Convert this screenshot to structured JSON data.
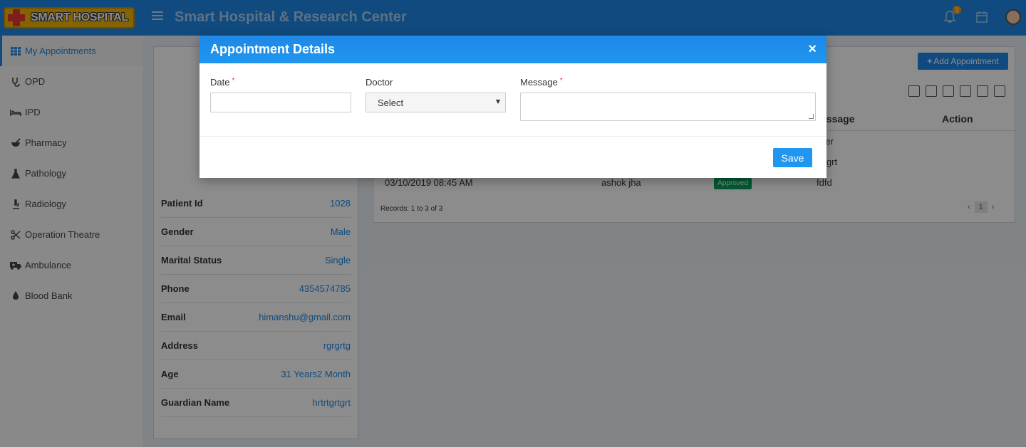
{
  "header": {
    "logo_text": "SMART HOSPITAL",
    "title": "Smart Hospital & Research Center",
    "notification_count": "3"
  },
  "sidebar": {
    "items": [
      {
        "label": "My Appointments",
        "icon": "calendar-grid-icon",
        "active": true
      },
      {
        "label": "OPD",
        "icon": "stethoscope-icon"
      },
      {
        "label": "IPD",
        "icon": "bed-icon"
      },
      {
        "label": "Pharmacy",
        "icon": "mortar-pestle-icon"
      },
      {
        "label": "Pathology",
        "icon": "flask-icon"
      },
      {
        "label": "Radiology",
        "icon": "microscope-icon"
      },
      {
        "label": "Operation Theatre",
        "icon": "scissors-icon"
      },
      {
        "label": "Ambulance",
        "icon": "ambulance-icon"
      },
      {
        "label": "Blood Bank",
        "icon": "blood-drop-icon"
      }
    ]
  },
  "profile": {
    "rows": [
      {
        "label": "Patient Id",
        "value": "1028"
      },
      {
        "label": "Gender",
        "value": "Male"
      },
      {
        "label": "Marital Status",
        "value": "Single"
      },
      {
        "label": "Phone",
        "value": "4354574785"
      },
      {
        "label": "Email",
        "value": "himanshu@gmail.com"
      },
      {
        "label": "Address",
        "value": "rgrgrtg"
      },
      {
        "label": "Age",
        "value": "31 Years2 Month"
      },
      {
        "label": "Guardian Name",
        "value": "hrtrtgrtgrt"
      }
    ]
  },
  "appointments": {
    "add_label": "Add Appointment",
    "headers": {
      "message": "essage",
      "action": "Action"
    },
    "rows": [
      {
        "message": "ver"
      },
      {
        "message": "rtgrt"
      },
      {
        "date": "03/10/2019 08:45 AM",
        "doctor": "ashok jha",
        "status": "Approved",
        "message": "fdfd"
      }
    ],
    "records": "Records: 1 to 3 of 3",
    "page": "1"
  },
  "modal": {
    "title": "Appointment Details",
    "close": "×",
    "date_label": "Date",
    "doctor_label": "Doctor",
    "doctor_value": "Select",
    "message_label": "Message",
    "required_mark": "*",
    "save_label": "Save"
  },
  "colors": {
    "primary": "#1e88e5",
    "approved": "#00a65a",
    "required": "#e53935"
  }
}
